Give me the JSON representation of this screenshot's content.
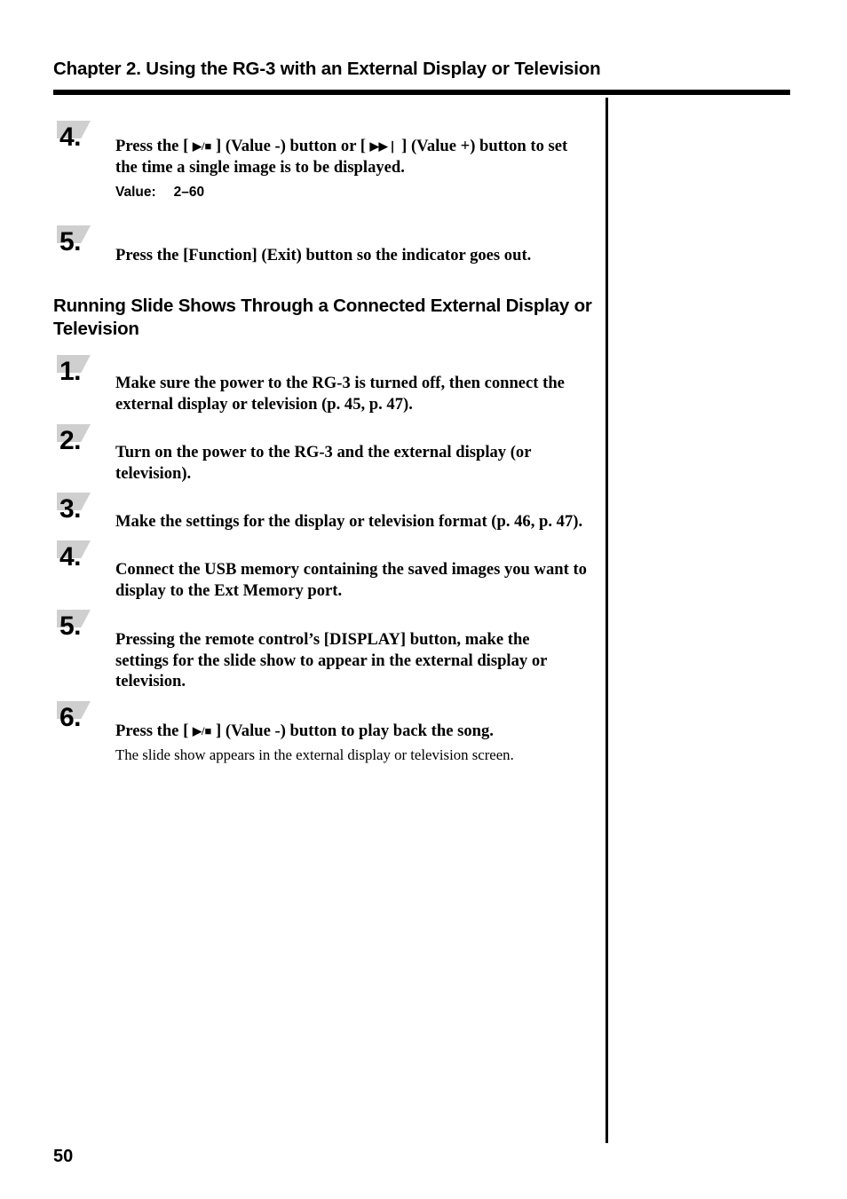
{
  "page": {
    "chapter_title": "Chapter 2. Using the RG-3 with an External Display or Television",
    "page_number": "50",
    "accent_color": "#000000",
    "marker_color": "#cfcfcf"
  },
  "section_heading": "Running Slide Shows Through a Connected External Display or Television",
  "steps_top": [
    {
      "number": "4.",
      "text_before_glyph1": "Press the [ ",
      "glyph1": "▶/■",
      "text_mid": " ] (Value -) button or [ ",
      "glyph2": "▶▶❘",
      "text_after": " ] (Value +) button to set the time a single image is to be displayed.",
      "value_label": "Value:",
      "value_text": "2–60"
    },
    {
      "number": "5.",
      "text": "Press the [Function] (Exit) button so the indicator goes out."
    }
  ],
  "steps_bottom": [
    {
      "number": "1.",
      "text": "Make sure the power to the RG-3 is turned off, then connect the external display or television (p. 45, p. 47)."
    },
    {
      "number": "2.",
      "text": "Turn on the power to the RG-3 and the external display (or television)."
    },
    {
      "number": "3.",
      "text": "Make the settings for the display or television format (p. 46, p. 47)."
    },
    {
      "number": "4.",
      "text": "Connect the USB memory containing the saved images you want to display to the Ext Memory port."
    },
    {
      "number": "5.",
      "text": "Pressing the remote control’s [DISPLAY] button, make the settings for the slide show to appear in the external display or television."
    },
    {
      "number": "6.",
      "text_before_glyph": "Press the [ ",
      "glyph": "▶/■",
      "text_after": " ] (Value -) button to play back the song.",
      "note": "The slide show appears in the external display or television screen."
    }
  ]
}
